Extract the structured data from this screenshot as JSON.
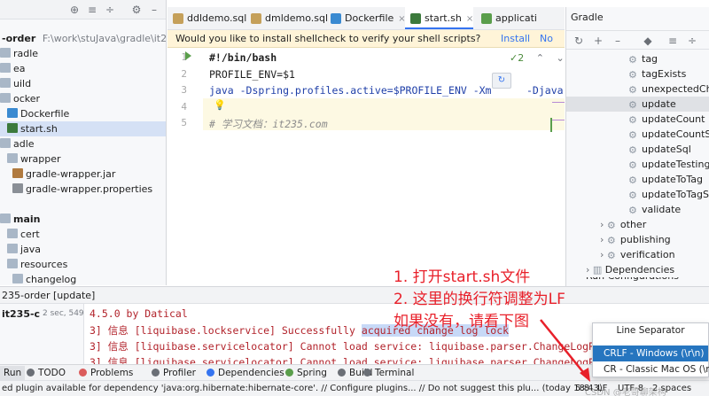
{
  "project": {
    "toolbar_icons": [
      "globe-icon",
      "collapse-icon",
      "expand-icon",
      "gear-icon",
      "minimize-icon"
    ],
    "root_label": "-order",
    "root_path": "F:\\work\\stuJava\\gradle\\it235-order",
    "items": [
      {
        "label": "radle",
        "icon": "folder"
      },
      {
        "label": "ea",
        "icon": "folder"
      },
      {
        "label": "uild",
        "icon": "folder"
      },
      {
        "label": "ocker",
        "icon": "folder"
      },
      {
        "label": "Dockerfile",
        "icon": "docker"
      },
      {
        "label": "start.sh",
        "icon": "sh"
      },
      {
        "label": "adle",
        "icon": "folder"
      },
      {
        "label": "wrapper",
        "icon": "folder"
      },
      {
        "label": "gradle-wrapper.jar",
        "icon": "jar"
      },
      {
        "label": "gradle-wrapper.properties",
        "icon": "props"
      },
      {
        "label": "",
        "icon": ""
      },
      {
        "label": "main",
        "icon": "folder"
      },
      {
        "label": "cert",
        "icon": "folder"
      },
      {
        "label": "java",
        "icon": "folder"
      },
      {
        "label": "resources",
        "icon": "folder"
      },
      {
        "label": "changelog",
        "icon": "folder"
      }
    ]
  },
  "tabs": [
    {
      "label": "ddldemo.sql",
      "close": "×"
    },
    {
      "label": "dmldemo.sql",
      "close": "×"
    },
    {
      "label": "Dockerfile",
      "close": "×"
    },
    {
      "label": "start.sh",
      "close": "×"
    },
    {
      "label": "applicati",
      "close": ""
    }
  ],
  "banner": {
    "text": "Would you like to install shellcheck to verify your shell scripts?",
    "install": "Install",
    "no": "No"
  },
  "editor": {
    "inspection_count": "2",
    "lines": [
      {
        "num": "1",
        "text": "#!/bin/bash"
      },
      {
        "num": "2",
        "text": "PROFILE_ENV=$1"
      },
      {
        "num": "3",
        "text": "java -Dspring.profiles.active=$PROFILE_ENV -Xm"
      },
      {
        "num": "4",
        "text": ""
      },
      {
        "num": "5",
        "text": "# 学习文档：it235.com"
      }
    ],
    "line3_tail": "-Djava."
  },
  "gradle": {
    "title": "Gradle",
    "tasks": [
      "tag",
      "tagExists",
      "unexpectedChan",
      "update",
      "updateCount",
      "updateCountSql",
      "updateSql",
      "updateTestingRo",
      "updateToTag",
      "updateToTagSql",
      "validate"
    ],
    "groups": [
      "other",
      "publishing",
      "verification"
    ],
    "deps": "Dependencies",
    "cut": "Run Configurations"
  },
  "run": {
    "header": "235-order [update]",
    "left_label": "it235-c",
    "left_time": "2 sec, 549 ms",
    "lines": [
      {
        "prefix": "",
        "text": "4.5.0 by Datical"
      },
      {
        "prefix": "3] 信息 ",
        "text": "[liquibase.lockservice] Successfully ",
        "hl": "acquired change log lock"
      },
      {
        "prefix": "3] 信息 ",
        "text": "[liquibase.servicelocator] Cannot load service: liquibase.parser.ChangeLogP",
        "hl": ""
      },
      {
        "prefix": "3] 信息 ",
        "text": "[liquibase.servicelocator] Cannot load service: liquibase.parser.ChangeLogP",
        "hl": ""
      }
    ]
  },
  "toolwindows": [
    {
      "label": "Run",
      "color": "#5a9e4b"
    },
    {
      "label": "TODO",
      "color": "#6b6f76"
    },
    {
      "label": "Problems",
      "color": "#db5c5c"
    },
    {
      "label": "Profiler",
      "color": "#6b6f76"
    },
    {
      "label": "Dependencies",
      "color": "#3574f0"
    },
    {
      "label": "Spring",
      "color": "#5a9e4b"
    },
    {
      "label": "Build",
      "color": "#6b6f76"
    },
    {
      "label": "Terminal",
      "color": "#6b6f76"
    }
  ],
  "status": {
    "message": "ed plugin available for dependency 'java:org.hibernate:hibernate-core'. // Configure plugins... // Do not suggest this plu... (today 18:43)",
    "position": "5:8",
    "line_sep": "LF",
    "encoding": "UTF-8",
    "indent": "2 spaces"
  },
  "popup": {
    "title": "Line Separator",
    "options": [
      "CRLF - Windows (\\r\\n)",
      "CR - Classic Mac OS (\\r)"
    ]
  },
  "annotation": {
    "line1": "1. 打开start.sh文件",
    "line2": "2. 这里的换行符调整为LF",
    "line3": "如果没有，请看下图"
  },
  "watermark": "CSDN @老哥聊架构",
  "colors": {
    "accent": "#3574f0",
    "annotation": "#e8202a",
    "selection": "#2675bf"
  }
}
